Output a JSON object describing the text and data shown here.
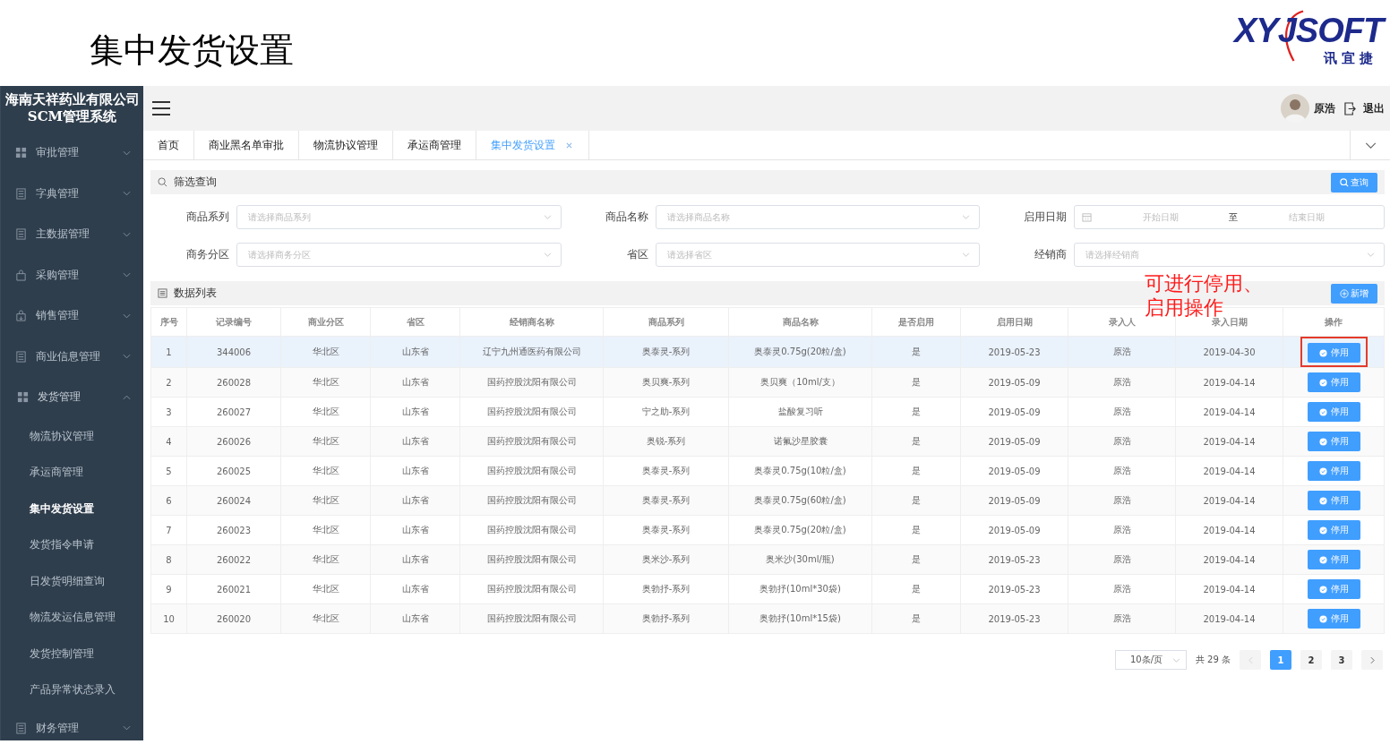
{
  "slide": {
    "title": "集中发货设置",
    "logo": {
      "text": "XYJSOFT",
      "subtitle": "讯宜捷"
    }
  },
  "sidebar": {
    "brand": "海南天祥药业有限公司SCM管理系统",
    "items": [
      {
        "label": "审批管理",
        "kind": "grid",
        "expanded": false
      },
      {
        "label": "字典管理",
        "kind": "doc",
        "expanded": false
      },
      {
        "label": "主数据管理",
        "kind": "doc",
        "expanded": false
      },
      {
        "label": "采购管理",
        "kind": "bag",
        "expanded": false
      },
      {
        "label": "销售管理",
        "kind": "bag-out",
        "expanded": false
      },
      {
        "label": "商业信息管理",
        "kind": "doc",
        "expanded": false
      },
      {
        "label": "发货管理",
        "kind": "grid",
        "expanded": true,
        "children": [
          {
            "label": "物流协议管理",
            "selected": false
          },
          {
            "label": "承运商管理",
            "selected": false
          },
          {
            "label": "集中发货设置",
            "selected": true
          },
          {
            "label": "发货指令申请",
            "selected": false
          },
          {
            "label": "日发货明细查询",
            "selected": false
          },
          {
            "label": "物流发运信息管理",
            "selected": false
          },
          {
            "label": "发货控制管理",
            "selected": false
          },
          {
            "label": "产品异常状态录入",
            "selected": false
          }
        ]
      },
      {
        "label": "财务管理",
        "kind": "doc",
        "expanded": false
      }
    ]
  },
  "header": {
    "user": "原浩",
    "logout": "退出"
  },
  "tabs": [
    {
      "label": "首页",
      "selected": false
    },
    {
      "label": "商业黑名单审批",
      "selected": false
    },
    {
      "label": "物流协议管理",
      "selected": false
    },
    {
      "label": "承运商管理",
      "selected": false
    },
    {
      "label": "集中发货设置",
      "selected": true
    }
  ],
  "filter": {
    "title": "筛选查询",
    "search_button": "查询",
    "fields": [
      {
        "label": "商品系列",
        "kind": "select",
        "placeholder": "请选择商品系列"
      },
      {
        "label": "商品名称",
        "kind": "select",
        "placeholder": "请选择商品名称"
      },
      {
        "label": "启用日期",
        "kind": "daterange",
        "start_placeholder": "开始日期",
        "separator": "至",
        "end_placeholder": "结束日期"
      },
      {
        "label": "商务分区",
        "kind": "select",
        "placeholder": "请选择商务分区"
      },
      {
        "label": "省区",
        "kind": "select",
        "placeholder": "请选择省区"
      },
      {
        "label": "经销商",
        "kind": "select",
        "placeholder": "请选择经销商"
      }
    ]
  },
  "list": {
    "title": "数据列表",
    "add_button": "新增"
  },
  "annotation": {
    "text": "可进行停用、启用操作"
  },
  "table": {
    "columns": [
      "序号",
      "记录编号",
      "商业分区",
      "省区",
      "经销商名称",
      "商品系列",
      "商品名称",
      "是否启用",
      "启用日期",
      "录入人",
      "录入日期",
      "操作"
    ],
    "rows": [
      {
        "cells": [
          "1",
          "344006",
          "华北区",
          "山东省",
          "辽宁九州通医药有限公司",
          "奥泰灵-系列",
          "奥泰灵0.75g(20粒/盒)",
          "是",
          "2019-05-23",
          "原浩",
          "2019-04-30"
        ],
        "action": "停用",
        "selected": true,
        "annotated": true
      },
      {
        "cells": [
          "2",
          "260028",
          "华北区",
          "山东省",
          "国药控股沈阳有限公司",
          "奥贝爽-系列",
          "奥贝爽（10ml/支）",
          "是",
          "2019-05-09",
          "原浩",
          "2019-04-14"
        ],
        "action": "停用",
        "selected": false,
        "annotated": false
      },
      {
        "cells": [
          "3",
          "260027",
          "华北区",
          "山东省",
          "国药控股沈阳有限公司",
          "宁之助-系列",
          "盐酸复习听",
          "是",
          "2019-05-09",
          "原浩",
          "2019-04-14"
        ],
        "action": "停用",
        "selected": false,
        "annotated": false
      },
      {
        "cells": [
          "4",
          "260026",
          "华北区",
          "山东省",
          "国药控股沈阳有限公司",
          "奥锐-系列",
          "诺氟沙星胶囊",
          "是",
          "2019-05-09",
          "原浩",
          "2019-04-14"
        ],
        "action": "停用",
        "selected": false,
        "annotated": false
      },
      {
        "cells": [
          "5",
          "260025",
          "华北区",
          "山东省",
          "国药控股沈阳有限公司",
          "奥泰灵-系列",
          "奥泰灵0.75g(10粒/盒)",
          "是",
          "2019-05-09",
          "原浩",
          "2019-04-14"
        ],
        "action": "停用",
        "selected": false,
        "annotated": false
      },
      {
        "cells": [
          "6",
          "260024",
          "华北区",
          "山东省",
          "国药控股沈阳有限公司",
          "奥泰灵-系列",
          "奥泰灵0.75g(60粒/盒)",
          "是",
          "2019-05-09",
          "原浩",
          "2019-04-14"
        ],
        "action": "停用",
        "selected": false,
        "annotated": false
      },
      {
        "cells": [
          "7",
          "260023",
          "华北区",
          "山东省",
          "国药控股沈阳有限公司",
          "奥泰灵-系列",
          "奥泰灵0.75g(20粒/盒)",
          "是",
          "2019-05-09",
          "原浩",
          "2019-04-14"
        ],
        "action": "停用",
        "selected": false,
        "annotated": false
      },
      {
        "cells": [
          "8",
          "260022",
          "华北区",
          "山东省",
          "国药控股沈阳有限公司",
          "奥米沙-系列",
          "奥米沙(30ml/瓶)",
          "是",
          "2019-05-23",
          "原浩",
          "2019-04-14"
        ],
        "action": "停用",
        "selected": false,
        "annotated": false
      },
      {
        "cells": [
          "9",
          "260021",
          "华北区",
          "山东省",
          "国药控股沈阳有限公司",
          "奥勃抒-系列",
          "奥勃抒(10ml*30袋)",
          "是",
          "2019-05-23",
          "原浩",
          "2019-04-14"
        ],
        "action": "停用",
        "selected": false,
        "annotated": false
      },
      {
        "cells": [
          "10",
          "260020",
          "华北区",
          "山东省",
          "国药控股沈阳有限公司",
          "奥勃抒-系列",
          "奥勃抒(10ml*15袋)",
          "是",
          "2019-05-23",
          "原浩",
          "2019-04-14"
        ],
        "action": "停用",
        "selected": false,
        "annotated": false
      }
    ]
  },
  "pagination": {
    "page_size": "10条/页",
    "total": "共 29 条",
    "pages": [
      {
        "label": "1",
        "selected": true
      },
      {
        "label": "2",
        "selected": false
      },
      {
        "label": "3",
        "selected": false
      }
    ]
  }
}
